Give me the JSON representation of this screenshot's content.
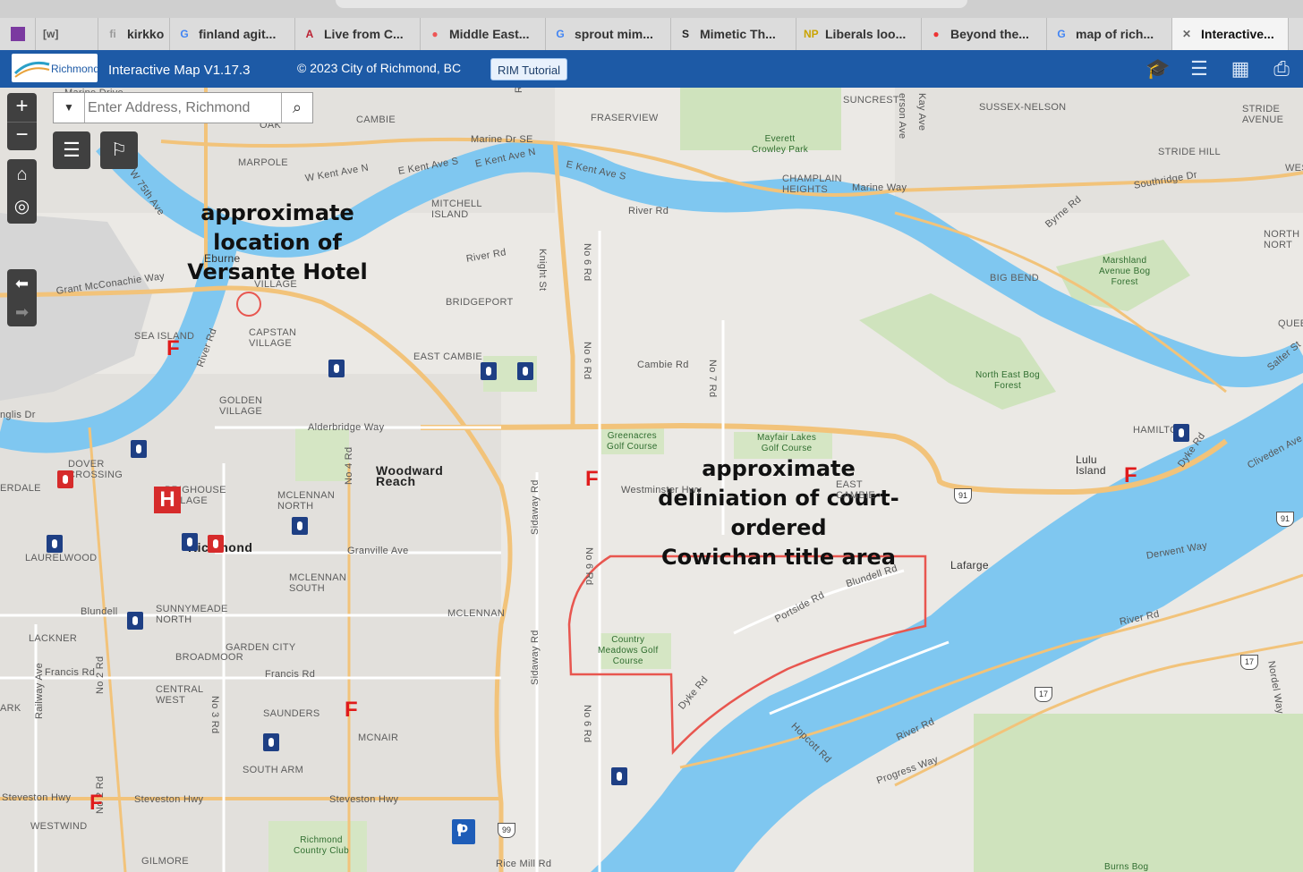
{
  "browser_tabs": [
    {
      "icon": "[w]",
      "label": ""
    },
    {
      "icon": "fi",
      "label": "kirkko"
    },
    {
      "icon": "G",
      "label": "finland agit..."
    },
    {
      "icon": "A",
      "label": "Live from C..."
    },
    {
      "icon": "●",
      "label": "Middle East..."
    },
    {
      "icon": "G",
      "label": "sprout mim..."
    },
    {
      "icon": "S",
      "label": "Mimetic Th..."
    },
    {
      "icon": "NP",
      "label": "Liberals loo..."
    },
    {
      "icon": "●",
      "label": "Beyond the..."
    },
    {
      "icon": "G",
      "label": "map of rich..."
    },
    {
      "icon": "✕",
      "label": "Interactive..."
    }
  ],
  "header": {
    "logo_text": "Richmond",
    "title": "Interactive Map V1.17.3",
    "copyright": "© 2023 City of Richmond, BC",
    "tutorial_button": "RIM Tutorial"
  },
  "search": {
    "placeholder": "Enter Address, Richmond"
  },
  "annotations": {
    "hotel_line1": "approximate",
    "hotel_line2": "location of",
    "hotel_line3": "Versante Hotel",
    "area_line1": "approximate",
    "area_line2": "deliniation of court-ordered",
    "area_line3": "Cowichan title area"
  },
  "places": {
    "cambie": "CAMBIE",
    "marpole": "MARPOLE",
    "fraserview": "FRASERVIEW",
    "suncrest": "SUNCREST",
    "sussex": "SUSSEX-NELSON",
    "stride_ave": "STRIDE\nAVENUE",
    "stride_hill": "STRIDE HILL",
    "champlain": "CHAMPLAIN\nHEIGHTS",
    "mitchell": "MITCHELL\nISLAND",
    "eburne": "Eburne",
    "village": "VILLAGE",
    "bridgeport": "BRIDGEPORT",
    "sea_island": "SEA ISLAND",
    "capstan": "CAPSTAN\nVILLAGE",
    "east_cambie": "EAST CAMBIE",
    "golden_village": "GOLDEN\nVILLAGE",
    "big_bend": "BIG BEND",
    "woodward": "Woodward\nReach",
    "dover": "DOVER\nCROSSING",
    "brighouse": "BRIGHOUSE\nVILLAGE",
    "mclennan_north": "MCLENNAN\nNORTH",
    "richmond": "Richmond",
    "laurelwood": "LAURELWOOD",
    "mclennan_south": "MCLENNAN\nSOUTH",
    "mclennan": "MCLENNAN",
    "sunnymeade": "SUNNYMEADE\nNORTH",
    "lackner": "LACKNER",
    "garden_city": "GARDEN CITY",
    "broadmoor": "BROADMOOR",
    "central_west": "CENTRAL\nWEST",
    "saunders": "SAUNDERS",
    "mcnair": "MCNAIR",
    "south_arm": "SOUTH ARM",
    "westwind": "WESTWIND",
    "gilmore": "GILMORE",
    "lulu_island": "Lulu\nIsland",
    "hamilton": "HAMILTON",
    "lafarge": "Lafarge",
    "east_cambie2": "EAST\nCAMBIE",
    "erdale": "ERDALE",
    "ark": "ARK",
    "north": "NORTH\nNORT",
    "quee": "QUEE",
    "wes": "WES"
  },
  "parks": {
    "everett": "Everett\nCrowley Park",
    "marshland": "Marshland\nAvenue Bog\nForest",
    "north_east_bog": "North East Bog\nForest",
    "greenacres": "Greenacres\nGolf Course",
    "mayfair": "Mayfair Lakes\nGolf Course",
    "country_meadows": "Country\nMeadows Golf\nCourse",
    "richmond_cc": "Richmond\nCountry Club",
    "burns_bog": "Burns Bog"
  },
  "roads": {
    "marine_dr_se": "Marine Dr SE",
    "marine_drive": "Marine Drive",
    "w_kent_n": "W Kent Ave N",
    "e_kent_s": "E Kent Ave S",
    "e_kent_n": "E Kent Ave N",
    "e_kent_s2": "E Kent Ave S",
    "marine_way": "Marine Way",
    "southridge": "Southridge Dr",
    "byrne": "Byrne Rd",
    "river_rd1": "River Rd",
    "river_rd2": "River Rd",
    "grant": "Grant McConachie Way",
    "river_rd3": "River Rd",
    "knight": "Knight St",
    "no6_1": "No 6 Rd",
    "no6_2": "No 6 Rd",
    "no6_3": "No 6 Rd",
    "no6_4": "No 6 Rd",
    "cambie_rd": "Cambie Rd",
    "no7": "No 7 Rd",
    "alderbridge": "Alderbridge Way",
    "no4": "No 4 Rd",
    "granville": "Granville Ave",
    "westminster": "Westminster Hwy",
    "sidaway1": "Sidaway Rd",
    "sidaway2": "Sidaway Rd",
    "blundell_rd": "Blundell Rd",
    "portside": "Portside Rd",
    "blundell": "Blundell",
    "francis": "Francis Rd",
    "francis2": "Francis Rd",
    "no3": "No 3 Rd",
    "no2": "No 2 Rd",
    "no2b": "No 2 Rd",
    "railway": "Railway Ave",
    "steveston1": "Steveston Hwy",
    "steveston2": "Steveston Hwy",
    "steveston3": "Steveston Hwy",
    "dyke": "Dyke Rd",
    "dyke2": "Dyke Rd",
    "hopcott": "Hopcott Rd",
    "river_rd4": "River Rd",
    "river_rd5": "River Rd",
    "progress": "Progress Way",
    "derwent": "Derwent Way",
    "cliveden": "Cliveden Ave",
    "salter": "Salter St",
    "nordel": "Nordel Way",
    "rice_mill": "Rice Mill Rd",
    "inglis": "nglis Dr",
    "w75": "W 75th Ave",
    "ross": "Ross St",
    "kay": "Kay Ave",
    "nelson": "erson Ave",
    "oak": "OAK"
  },
  "shields": {
    "h91a": "91",
    "h91b": "91",
    "h99": "99",
    "h17a": "17",
    "h17b": "17"
  },
  "markers": {
    "fire": "F",
    "hospital": "H",
    "parking": "P"
  },
  "colors": {
    "header": "#1d5aa6",
    "water": "#7fc7f0",
    "annotation": "#e8564f",
    "fire": "#e01b1b"
  }
}
